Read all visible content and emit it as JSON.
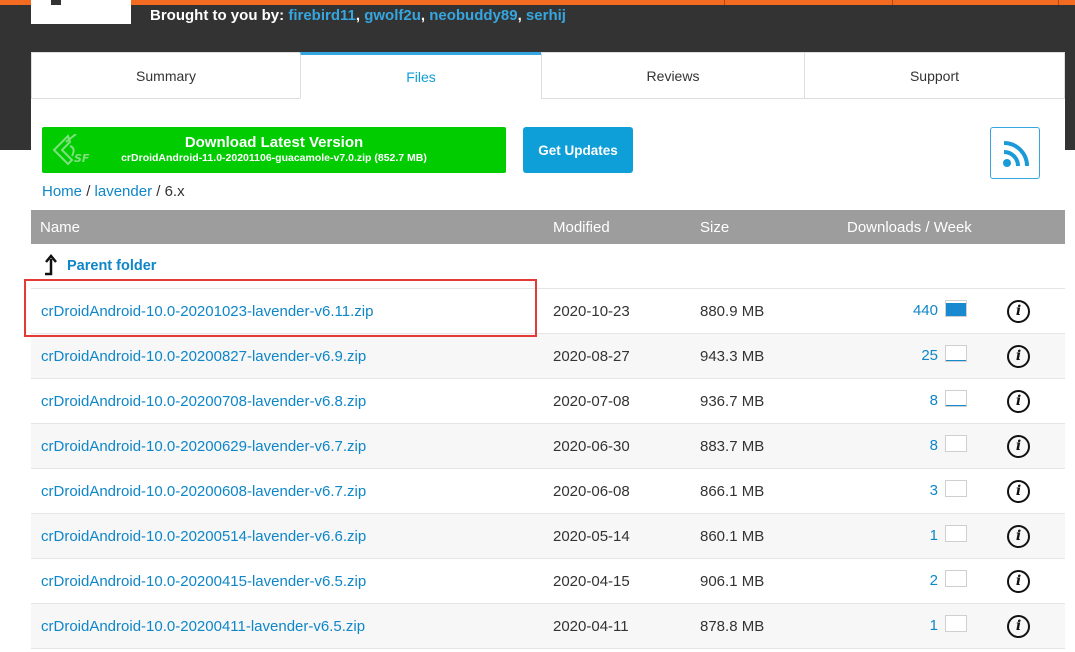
{
  "header": {
    "brought_prefix": "Brought to you by:",
    "authors": [
      "firebird11",
      "gwolf2u",
      "neobuddy89",
      "serhij"
    ]
  },
  "tabs": [
    {
      "label": "Summary",
      "active": false
    },
    {
      "label": "Files",
      "active": true
    },
    {
      "label": "Reviews",
      "active": false
    },
    {
      "label": "Support",
      "active": false
    }
  ],
  "download": {
    "title": "Download Latest Version",
    "file": "crDroidAndroid-11.0-20201106-guacamole-v7.0.zip (852.7 MB)"
  },
  "get_updates_label": "Get Updates",
  "breadcrumb": {
    "home": "Home",
    "sep": "/",
    "folder": "lavender",
    "current": "6.x"
  },
  "table": {
    "headers": {
      "name": "Name",
      "modified": "Modified",
      "size": "Size",
      "downloads": "Downloads / Week"
    },
    "parent_label": "Parent folder",
    "rows": [
      {
        "name": "crDroidAndroid-10.0-20201023-lavender-v6.11.zip",
        "modified": "2020-10-23",
        "size": "880.9 MB",
        "downloads": "440"
      },
      {
        "name": "crDroidAndroid-10.0-20200827-lavender-v6.9.zip",
        "modified": "2020-08-27",
        "size": "943.3 MB",
        "downloads": "25"
      },
      {
        "name": "crDroidAndroid-10.0-20200708-lavender-v6.8.zip",
        "modified": "2020-07-08",
        "size": "936.7 MB",
        "downloads": "8"
      },
      {
        "name": "crDroidAndroid-10.0-20200629-lavender-v6.7.zip",
        "modified": "2020-06-30",
        "size": "883.7 MB",
        "downloads": "8"
      },
      {
        "name": "crDroidAndroid-10.0-20200608-lavender-v6.7.zip",
        "modified": "2020-06-08",
        "size": "866.1 MB",
        "downloads": "3"
      },
      {
        "name": "crDroidAndroid-10.0-20200514-lavender-v6.6.zip",
        "modified": "2020-05-14",
        "size": "860.1 MB",
        "downloads": "1"
      },
      {
        "name": "crDroidAndroid-10.0-20200415-lavender-v6.5.zip",
        "modified": "2020-04-15",
        "size": "906.1 MB",
        "downloads": "2"
      },
      {
        "name": "crDroidAndroid-10.0-20200411-lavender-v6.5.zip",
        "modified": "2020-04-11",
        "size": "878.8 MB",
        "downloads": "1"
      }
    ]
  },
  "colors": {
    "accent": "#0e9ed8",
    "download_green": "#00cc00",
    "header_dark": "#333333",
    "orange": "#f36b21",
    "highlight_red": "#e53935"
  },
  "icons": [
    "sourceforge-icon",
    "rss-icon",
    "parent-arrow-icon",
    "info-icon",
    "sparkline-chart-icon"
  ]
}
